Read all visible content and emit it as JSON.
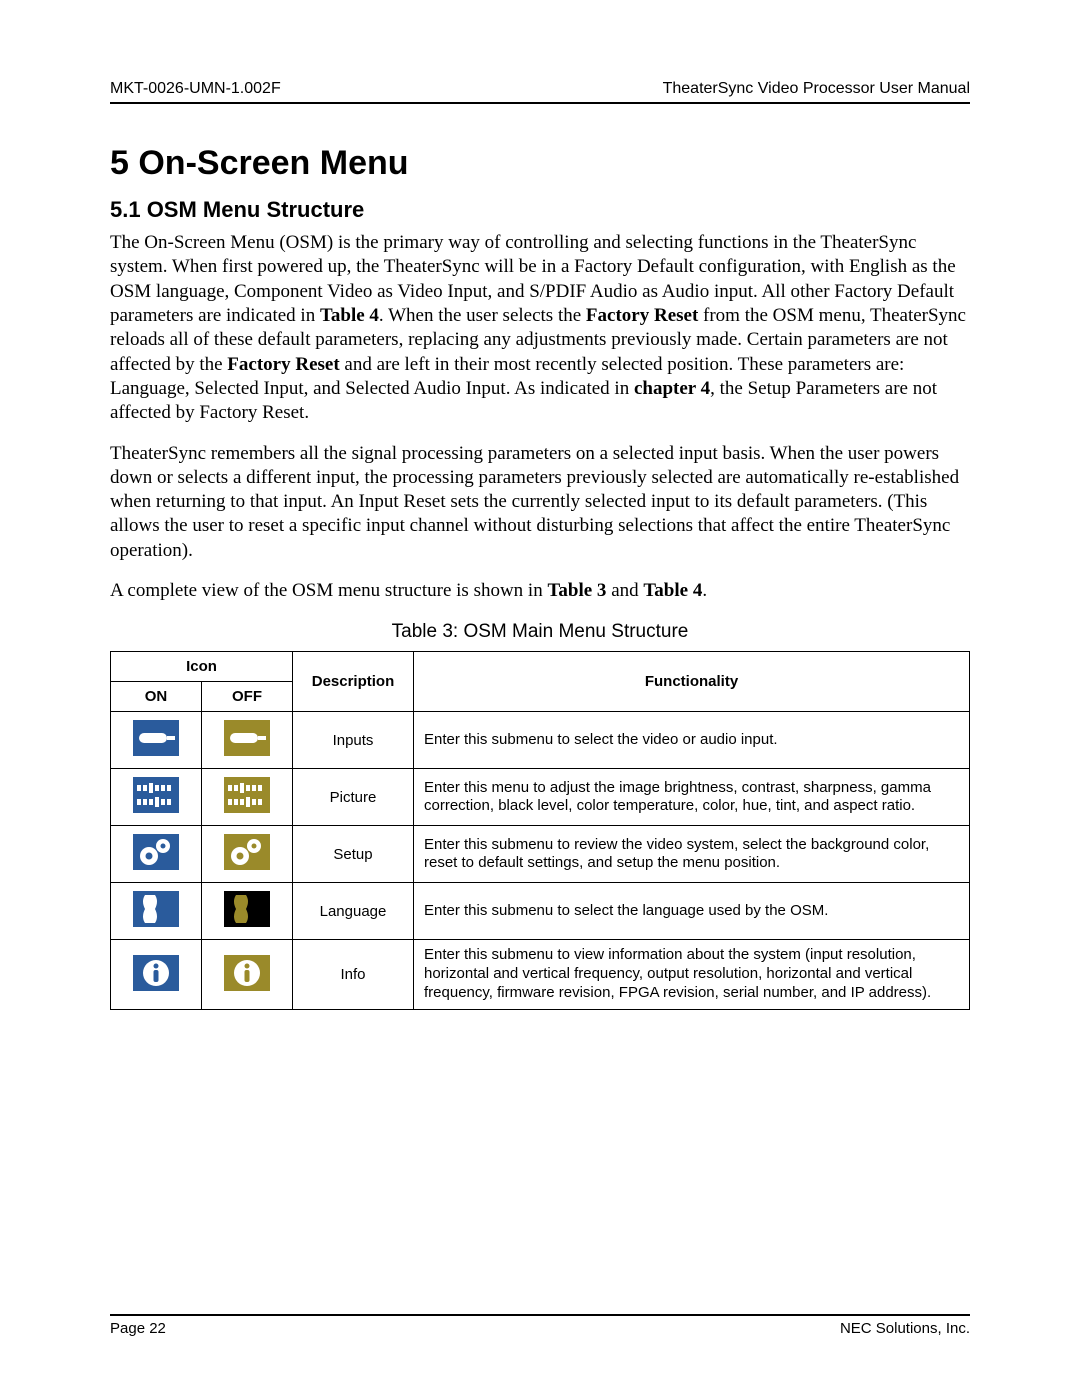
{
  "header": {
    "left": "MKT-0026-UMN-1.002F",
    "right": "TheaterSync Video Processor User Manual"
  },
  "chapter": "5  On-Screen Menu",
  "section": "5.1   OSM Menu Structure",
  "para1_parts": {
    "a": "The On-Screen Menu (OSM) is the primary way of controlling and selecting functions in the TheaterSync system. When first powered up, the TheaterSync will be in a Factory Default configuration, with English as the OSM language, Component Video as Video Input, and S/PDIF Audio as Audio input. All other Factory Default parameters are indicated in ",
    "b_bold": "Table 4",
    "c": ". When the user selects the ",
    "d_bold": "Factory Reset",
    "e": " from the OSM menu, TheaterSync reloads all of these default parameters, replacing any adjustments previously made. Certain parameters are not affected by the ",
    "f_bold": "Factory Reset",
    "g": " and are left in their most recently selected position. These parameters are: Language, Selected Input, and Selected Audio Input. As indicated in ",
    "h_bold": "chapter 4",
    "i": ", the Setup Parameters are not affected by Factory Reset."
  },
  "para2": "TheaterSync remembers all the signal processing parameters on a selected input basis. When the user powers down or selects a different input, the processing parameters previously selected are automatically re-established when returning to that input. An Input Reset sets the currently selected input to its default parameters. (This allows the user to reset a specific input channel without disturbing selections that affect the entire TheaterSync operation).",
  "para3_parts": {
    "a": "A complete view of the OSM menu structure is shown in ",
    "b_bold": "Table 3",
    "c": " and ",
    "d_bold": "Table 4",
    "e": "."
  },
  "table_caption": "Table 3: OSM Main Menu Structure",
  "table": {
    "head": {
      "icon": "Icon",
      "on": "ON",
      "off": "OFF",
      "desc": "Description",
      "func": "Functionality"
    },
    "rows": [
      {
        "desc": "Inputs",
        "func": "Enter this submenu to select the video or audio input."
      },
      {
        "desc": "Picture",
        "func": "Enter this menu to adjust the image brightness, contrast, sharpness, gamma correction, black level, color temperature, color, hue, tint, and aspect ratio."
      },
      {
        "desc": "Setup",
        "func": "Enter this submenu to review the video system, select the background color, reset to default settings, and setup the menu position."
      },
      {
        "desc": "Language",
        "func": "Enter this submenu to select the language used by the OSM."
      },
      {
        "desc": "Info",
        "func": "Enter this submenu to view information about the system (input resolution, horizontal and vertical frequency, output resolution, horizontal and vertical frequency, firmware revision, FPGA revision, serial number, and IP address)."
      }
    ]
  },
  "colors": {
    "on": "#2a5b9c",
    "off": "#9a8a2a"
  },
  "footer": {
    "left": "Page 22",
    "right": "NEC Solutions, Inc."
  }
}
